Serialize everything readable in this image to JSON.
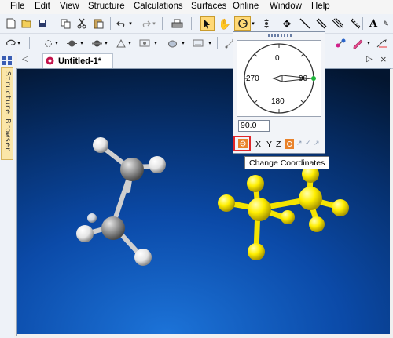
{
  "menubar": {
    "items": [
      "File",
      "Edit",
      "View",
      "Structure",
      "Calculations",
      "Surfaces",
      "Online",
      "Window",
      "Help"
    ]
  },
  "toolbar": {
    "row1_icons": [
      "new-icon",
      "open-icon",
      "save-icon",
      "copy-icon",
      "cut-icon",
      "paste-icon",
      "undo-icon",
      "redo-icon",
      "print-icon",
      "select-icon",
      "hand-icon",
      "rotate-icon",
      "chevron-down-icon",
      "zoom-icon",
      "translate-icon",
      "bond-single-icon",
      "bond-double-icon",
      "bond-triple-icon",
      "bond-aromatic-icon",
      "text-icon"
    ]
  },
  "document": {
    "tab_title": "Untitled-1*"
  },
  "sidebar": {
    "browser_label": "Structure Browser"
  },
  "rotate_panel": {
    "dial_labels": {
      "top": "0",
      "left": "270",
      "right": "90",
      "bottom": "180"
    },
    "angle_value": "90.0",
    "axis_buttons": [
      "X",
      "Y",
      "Z"
    ],
    "tooltip": "Change Coordinates"
  },
  "colors": {
    "accent_highlight": "#e0262a",
    "active_tool": "#ffd977",
    "carbon": "#9a9a9a",
    "hydrogen": "#ffffff",
    "selected_atom": "#ffee00",
    "dial_indicator": "#1db53a"
  }
}
